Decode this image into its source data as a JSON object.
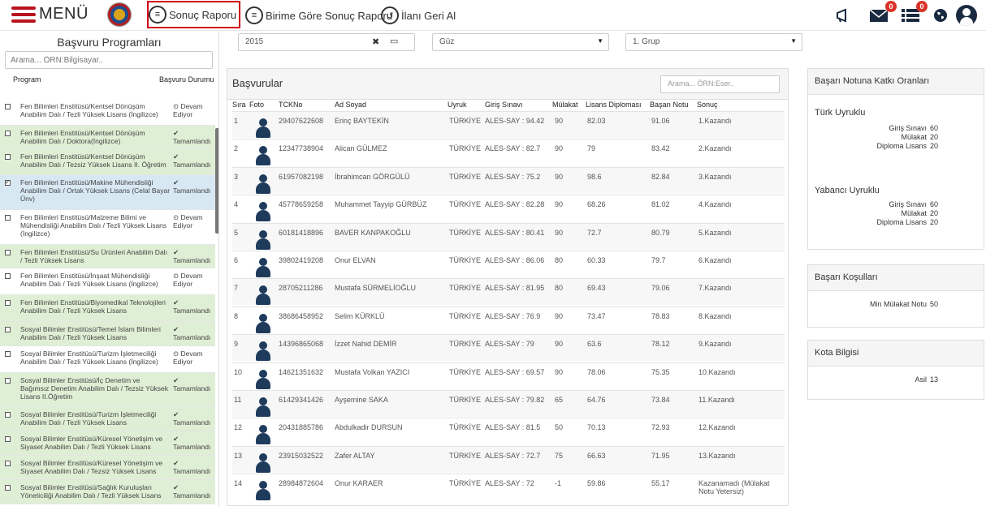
{
  "header": {
    "menu_label": "MENÜ",
    "items": [
      {
        "label": "Sonuç Raporu",
        "icon": "document-icon"
      },
      {
        "label": "Birime Göre Sonuç Raporu",
        "icon": "document-icon"
      },
      {
        "label": "İlanı Geri Al",
        "icon": "undo-icon"
      }
    ],
    "messages_badge": "0",
    "list_badge": "0"
  },
  "sidebar": {
    "title": "Başvuru Programları",
    "search_placeholder": "Arama... ÖRN:Bilgisayar..",
    "col_program": "Program",
    "col_status": "Başvuru Durumu",
    "items": [
      {
        "program": "Fen Bilimleri Enstitüsü/Kentsel Dönüşüm Anabilim Dalı / Tezli Yüksek Lisans (İngilizce)",
        "status": "⊙ Devam Ediyor"
      },
      {
        "program": "Fen Bilimleri Enstitüsü/Kentsel Dönüşüm Anabilim Dalı / Doktora(İngilizce)",
        "status": "✔ Tamamlandı"
      },
      {
        "program": "Fen Bilimleri Enstitüsü/Kentsel Dönüşüm Anabilim Dalı / Tezsiz Yüksek Lisans II. Öğretim",
        "status": "✔ Tamamlandı"
      },
      {
        "program": "Fen Bilimleri Enstitüsü/Makine Mühendisliği Anabilim Dalı / Ortak Yüksek Lisans (Celal Bayar Ünv)",
        "status": "✔ Tamamlandı"
      },
      {
        "program": "Fen Bilimleri Enstitüsü/Malzeme Bilimi ve Mühendisliği Anabilim Dalı / Tezli Yüksek Lisans (İngilizce)",
        "status": "⊙ Devam Ediyor"
      },
      {
        "program": "Fen Bilimleri Enstitüsü/Su Ürünleri Anabilim Dalı / Tezli Yüksek Lisans",
        "status": "✔ Tamamlandı"
      },
      {
        "program": "Fen Bilimleri Enstitüsü/İnşaat Mühendisliği Anabilim Dalı / Tezli Yüksek Lisans (İngilizce)",
        "status": "⊙ Devam Ediyor"
      },
      {
        "program": "Fen Bilimleri Enstitüsü/Biyomedikal Teknolojileri Anabilim Dalı / Tezli Yüksek Lisans",
        "status": "✔ Tamamlandı"
      },
      {
        "program": "Sosyal Bilimler Enstitüsü/Temel İslam Bilimleri Anabilim Dalı / Tezli Yüksek Lisans",
        "status": "✔ Tamamlandı"
      },
      {
        "program": "Sosyal Bilimler Enstitüsü/Turizm İşletmeciliği Anabilim Dalı / Tezli Yüksek Lisans (İngilizce)",
        "status": "⊙ Devam Ediyor"
      },
      {
        "program": "Sosyal Bilimler Enstitüsü/İç Denetim ve Bağımsız Denetim Anabilim Dalı / Tezsiz Yüksek Lisans II.Öğretim",
        "status": "✔ Tamamlandı"
      },
      {
        "program": "Sosyal Bilimler Enstitüsü/Turizm İşletmeciliği Anabilim Dalı / Tezli Yüksek Lisans",
        "status": "✔ Tamamlandı"
      },
      {
        "program": "Sosyal Bilimler Enstitüsü/Küresel Yönetişim ve Siyaset Anabilim Dalı / Tezli Yüksek Lisans",
        "status": "✔ Tamamlandı"
      },
      {
        "program": "Sosyal Bilimler Enstitüsü/Küresel Yönetişim ve Siyaset Anabilim Dalı / Tezsiz Yüksek Lisans",
        "status": "✔ Tamamlandı"
      },
      {
        "program": "Sosyal Bilimler Enstitüsü/Sağlık Kuruluşları Yöneticiliği Anabilim Dalı / Tezli Yüksek Lisans",
        "status": "✔ Tamamlandı"
      }
    ]
  },
  "filters": {
    "year": "2015",
    "term": "Güz",
    "group": "1. Grup"
  },
  "main": {
    "title": "Başvurular",
    "search_placeholder": "Arama... ÖRN:Eser..",
    "columns": [
      "Sıra",
      "Foto",
      "TCKNo",
      "Ad Soyad",
      "Uyruk",
      "Giriş Sınavı",
      "Mülakat",
      "Lisans Diploması",
      "Başarı Notu",
      "Sonuç"
    ],
    "rows": [
      {
        "no": "1",
        "tc": "29407622608",
        "name": "Erinç BAYTEKİN",
        "nat": "TÜRKİYE",
        "exam": "ALES-SAY : 94.42",
        "interview": "90",
        "diploma": "82.03",
        "score": "91.06",
        "result": "1.Kazandı"
      },
      {
        "no": "2",
        "tc": "12347738904",
        "name": "Alican GÜLMEZ",
        "nat": "TÜRKİYE",
        "exam": "ALES-SAY : 82.7",
        "interview": "90",
        "diploma": "79",
        "score": "83.42",
        "result": "2.Kazandı"
      },
      {
        "no": "3",
        "tc": "61957082198",
        "name": "İbrahimcan GÖRGÜLÜ",
        "nat": "TÜRKİYE",
        "exam": "ALES-SAY : 75.2",
        "interview": "90",
        "diploma": "98.6",
        "score": "82.84",
        "result": "3.Kazandı"
      },
      {
        "no": "4",
        "tc": "45778659258",
        "name": "Muhammet Tayyip GÜRBÜZ",
        "nat": "TÜRKİYE",
        "exam": "ALES-SAY : 82.28",
        "interview": "90",
        "diploma": "68.26",
        "score": "81.02",
        "result": "4.Kazandı"
      },
      {
        "no": "5",
        "tc": "60181418896",
        "name": "BAVER KANPAKOĞLU",
        "nat": "TÜRKİYE",
        "exam": "ALES-SAY : 80.41",
        "interview": "90",
        "diploma": "72.7",
        "score": "80.79",
        "result": "5.Kazandı"
      },
      {
        "no": "6",
        "tc": "39802419208",
        "name": "Onur ELVAN",
        "nat": "TÜRKİYE",
        "exam": "ALES-SAY : 86.06",
        "interview": "80",
        "diploma": "60.33",
        "score": "79.7",
        "result": "6.Kazandı"
      },
      {
        "no": "7",
        "tc": "28705211286",
        "name": "Mustafa SÜRMELİOĞLU",
        "nat": "TÜRKİYE",
        "exam": "ALES-SAY : 81.95",
        "interview": "80",
        "diploma": "69.43",
        "score": "79.06",
        "result": "7.Kazandı"
      },
      {
        "no": "8",
        "tc": "38686458952",
        "name": "Selim KÜRKLÜ",
        "nat": "TÜRKİYE",
        "exam": "ALES-SAY : 76.9",
        "interview": "90",
        "diploma": "73.47",
        "score": "78.83",
        "result": "8.Kazandı"
      },
      {
        "no": "9",
        "tc": "14396865068",
        "name": "İzzet Nahid DEMİR",
        "nat": "TÜRKİYE",
        "exam": "ALES-SAY : 79",
        "interview": "90",
        "diploma": "63.6",
        "score": "78.12",
        "result": "9.Kazandı"
      },
      {
        "no": "10",
        "tc": "14621351632",
        "name": "Mustafa Volkan YAZICI",
        "nat": "TÜRKİYE",
        "exam": "ALES-SAY : 69.57",
        "interview": "90",
        "diploma": "78.06",
        "score": "75.35",
        "result": "10.Kazandı"
      },
      {
        "no": "11",
        "tc": "61429341426",
        "name": "Ayşemine SAKA",
        "nat": "TÜRKİYE",
        "exam": "ALES-SAY : 79.82",
        "interview": "65",
        "diploma": "64.76",
        "score": "73.84",
        "result": "11.Kazandı"
      },
      {
        "no": "12",
        "tc": "20431885786",
        "name": "Abdulkadir DURSUN",
        "nat": "TÜRKİYE",
        "exam": "ALES-SAY : 81.5",
        "interview": "50",
        "diploma": "70.13",
        "score": "72.93",
        "result": "12.Kazandı"
      },
      {
        "no": "13",
        "tc": "23915032522",
        "name": "Zafer ALTAY",
        "nat": "TÜRKİYE",
        "exam": "ALES-SAY : 72.7",
        "interview": "75",
        "diploma": "66.63",
        "score": "71.95",
        "result": "13.Kazandı"
      },
      {
        "no": "14",
        "tc": "28984872604",
        "name": "Onur KARAER",
        "nat": "TÜRKİYE",
        "exam": "ALES-SAY : 72",
        "interview": "-1",
        "diploma": "59.86",
        "score": "55.17",
        "result": "Kazanamadı (Mülakat Notu Yetersiz)"
      }
    ]
  },
  "right": {
    "contrib_title": "Başarı Notuna Katkı Oranları",
    "turk_label": "Türk Uyruklu",
    "turk": [
      {
        "k": "Giriş Sınavı",
        "v": "60"
      },
      {
        "k": "Mülakat",
        "v": "20"
      },
      {
        "k": "Diploma Lisans",
        "v": "20"
      }
    ],
    "foreign_label": "Yabancı Uyruklu",
    "foreign": [
      {
        "k": "Giriş Sınavı",
        "v": "60"
      },
      {
        "k": "Mülakat",
        "v": "20"
      },
      {
        "k": "Diploma Lisans",
        "v": "20"
      }
    ],
    "cond_title": "Başarı Koşulları",
    "cond": [
      {
        "k": "Min Mülakat Notu",
        "v": "50"
      }
    ],
    "quota_title": "Kota Bilgisi",
    "quota": [
      {
        "k": "Asil",
        "v": "13"
      }
    ]
  }
}
